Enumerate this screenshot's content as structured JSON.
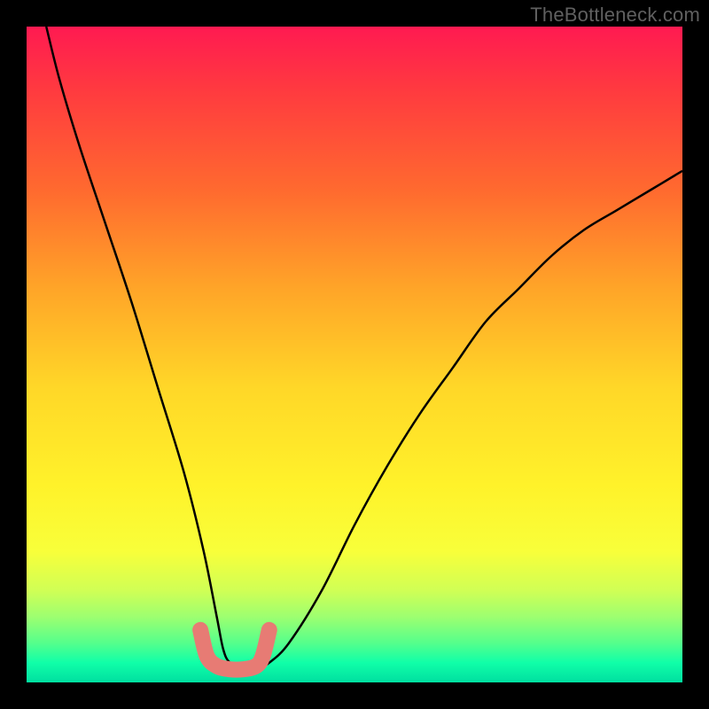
{
  "watermark": "TheBottleneck.com",
  "chart_data": {
    "type": "line",
    "title": "",
    "xlabel": "",
    "ylabel": "",
    "xlim": [
      0,
      100
    ],
    "ylim": [
      0,
      100
    ],
    "background": "rainbow-gradient-red-to-green",
    "series": [
      {
        "name": "bottleneck-curve",
        "x": [
          3,
          5,
          8,
          12,
          16,
          20,
          24,
          27,
          29,
          30,
          31,
          33,
          35,
          37,
          40,
          45,
          50,
          55,
          60,
          65,
          70,
          75,
          80,
          85,
          90,
          95,
          100
        ],
        "values": [
          100,
          92,
          82,
          70,
          58,
          45,
          32,
          20,
          10,
          5,
          3,
          2,
          2,
          3,
          6,
          14,
          24,
          33,
          41,
          48,
          55,
          60,
          65,
          69,
          72,
          75,
          78
        ]
      },
      {
        "name": "bottom-marker-band",
        "x": [
          26.5,
          27.5,
          29,
          31,
          33,
          35,
          36,
          37
        ],
        "values": [
          8,
          4,
          2.5,
          2,
          2,
          2.5,
          4,
          8
        ]
      }
    ],
    "annotations": []
  }
}
